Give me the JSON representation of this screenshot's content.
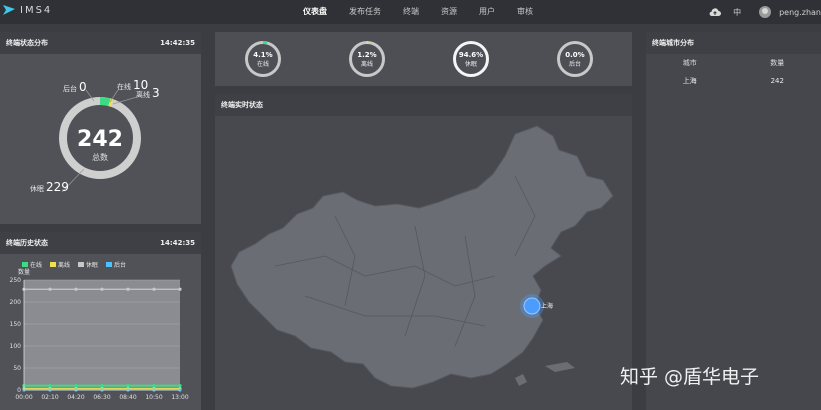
{
  "app": {
    "title": "IMS4"
  },
  "nav": {
    "items": [
      "仪表盘",
      "发布任务",
      "终端",
      "资源",
      "用户",
      "审核"
    ],
    "active_index": 0
  },
  "header": {
    "lang": "中",
    "user": "peng.zhan"
  },
  "status_panel": {
    "title": "终端状态分布",
    "time": "14:42:35",
    "total_label": "总数",
    "total": "242",
    "offline_label": "后台",
    "offline_value": "0",
    "online_label": "在线",
    "online_value": "10",
    "away_label": "离线",
    "away_value": "3",
    "sleep_label": "休眠",
    "sleep_value": "229"
  },
  "history_panel": {
    "title": "终端历史状态",
    "time": "14:42:35",
    "legend": [
      "在线",
      "离线",
      "休眠",
      "后台"
    ],
    "y_label": "数量"
  },
  "kpis": [
    {
      "value": "4.1%",
      "label": "在线"
    },
    {
      "value": "1.2%",
      "label": "离线"
    },
    {
      "value": "94.6%",
      "label": "休眠"
    },
    {
      "value": "0.0%",
      "label": "后台"
    }
  ],
  "map_panel": {
    "title": "终端实时状态",
    "marker_label": "上海"
  },
  "city_panel": {
    "title": "终端城市分布",
    "columns": [
      "城市",
      "数量"
    ],
    "rows": [
      {
        "city": "上海",
        "count": "242"
      }
    ]
  },
  "watermark": "知乎 @盾华电子",
  "colors": {
    "online": "#3ddc84",
    "offline": "#f0e050",
    "sleep": "#c8c8c8",
    "backstage": "#4cc3ff",
    "marker": "#4a9dff"
  },
  "chart_data": {
    "type": "line",
    "x": [
      "00:00",
      "02:10",
      "04:20",
      "06:30",
      "08:40",
      "10:50",
      "13:00"
    ],
    "ylabel": "数量",
    "ylim": [
      0,
      250
    ],
    "yticks": [
      0,
      50,
      100,
      150,
      200,
      250
    ],
    "series": [
      {
        "name": "在线",
        "values": [
          10,
          10,
          10,
          10,
          10,
          10,
          10
        ]
      },
      {
        "name": "离线",
        "values": [
          3,
          3,
          3,
          3,
          3,
          3,
          3
        ]
      },
      {
        "name": "休眠",
        "values": [
          229,
          229,
          229,
          229,
          229,
          229,
          229
        ]
      },
      {
        "name": "后台",
        "values": [
          0,
          0,
          0,
          0,
          0,
          0,
          0
        ]
      }
    ]
  }
}
